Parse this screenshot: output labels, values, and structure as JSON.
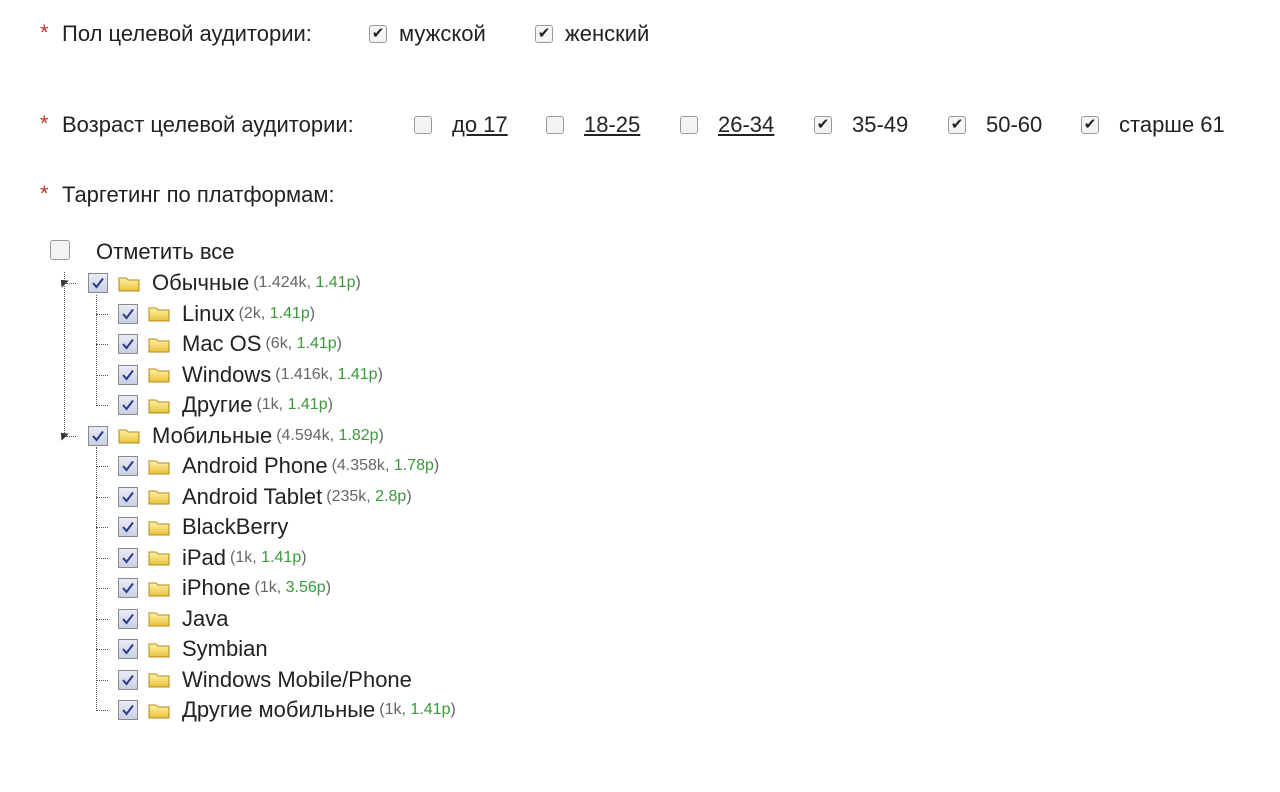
{
  "gender": {
    "label": "Пол целевой аудитории:",
    "options": [
      {
        "label": "мужской",
        "checked": true
      },
      {
        "label": "женский",
        "checked": true
      }
    ]
  },
  "age": {
    "label": "Возраст целевой аудитории:",
    "options": [
      {
        "label": "до 17",
        "checked": false
      },
      {
        "label": "18-25",
        "checked": false
      },
      {
        "label": "26-34",
        "checked": false
      },
      {
        "label": "35-49",
        "checked": true
      },
      {
        "label": "50-60",
        "checked": true
      },
      {
        "label": "старше 61",
        "checked": true
      }
    ]
  },
  "platforms": {
    "label": "Таргетинг по платформам:",
    "select_all_label": "Отметить все",
    "groups": [
      {
        "name": "Обычные",
        "count": "1.424k",
        "price": "1.41р",
        "children": [
          {
            "name": "Linux",
            "count": "2k",
            "price": "1.41р"
          },
          {
            "name": "Mac OS",
            "count": "6k",
            "price": "1.41р"
          },
          {
            "name": "Windows",
            "count": "1.416k",
            "price": "1.41р"
          },
          {
            "name": "Другие",
            "count": "1k",
            "price": "1.41р"
          }
        ]
      },
      {
        "name": "Мобильные",
        "count": "4.594k",
        "price": "1.82р",
        "children": [
          {
            "name": "Android Phone",
            "count": "4.358k",
            "price": "1.78р"
          },
          {
            "name": "Android Tablet",
            "count": "235k",
            "price": "2.8р"
          },
          {
            "name": "BlackBerry",
            "count": "",
            "price": ""
          },
          {
            "name": "iPad",
            "count": "1k",
            "price": "1.41р"
          },
          {
            "name": "iPhone",
            "count": "1k",
            "price": "3.56р"
          },
          {
            "name": "Java",
            "count": "",
            "price": ""
          },
          {
            "name": "Symbian",
            "count": "",
            "price": ""
          },
          {
            "name": "Windows Mobile/Phone",
            "count": "",
            "price": ""
          },
          {
            "name": "Другие мобильные",
            "count": "1k",
            "price": "1.41р"
          }
        ]
      }
    ]
  },
  "colors": {
    "required_star": "#c0392b",
    "price": "#3a9a3a",
    "meta": "#666666"
  }
}
